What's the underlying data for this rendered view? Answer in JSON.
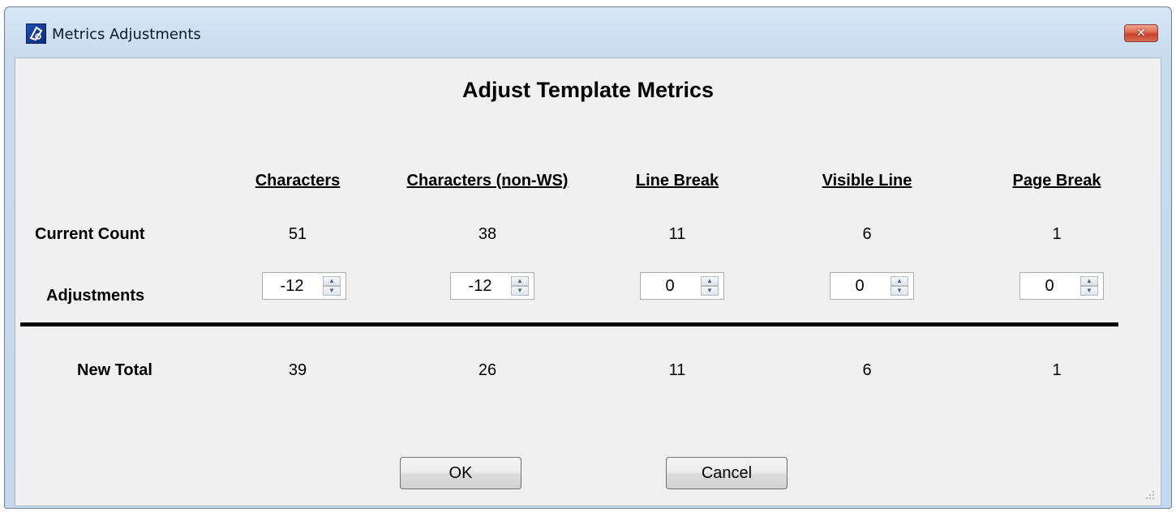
{
  "window": {
    "title": "Metrics Adjustments",
    "close_glyph": "✕"
  },
  "dialog": {
    "heading": "Adjust Template Metrics"
  },
  "columns": [
    {
      "header": "Characters",
      "current": "51",
      "adjustment": "-12",
      "new_total": "39"
    },
    {
      "header": "Characters (non-WS)",
      "current": "38",
      "adjustment": "-12",
      "new_total": "26"
    },
    {
      "header": "Line Break",
      "current": "11",
      "adjustment": "0",
      "new_total": "11"
    },
    {
      "header": "Visible Line",
      "current": "6",
      "adjustment": "0",
      "new_total": "6"
    },
    {
      "header": "Page Break",
      "current": "1",
      "adjustment": "0",
      "new_total": "1"
    }
  ],
  "rows": {
    "current_label": "Current Count",
    "adjustments_label": "Adjustments",
    "new_total_label": "New Total"
  },
  "buttons": {
    "ok": "OK",
    "cancel": "Cancel"
  },
  "icons": {
    "app": "app-logo-icon",
    "close": "close-icon",
    "spin_up": "spin-up-icon",
    "spin_down": "spin-down-icon",
    "grip": "resize-grip-icon"
  }
}
